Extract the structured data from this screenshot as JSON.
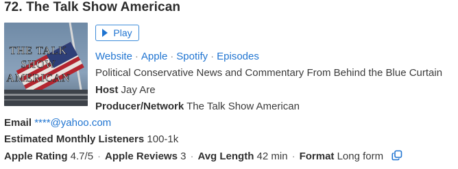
{
  "header": {
    "title": "72. The Talk Show American"
  },
  "cover": {
    "text_line1": "THE TALK",
    "text_line2": "SHOW",
    "text_line3": "AMERICAN"
  },
  "play_button": {
    "label": "Play",
    "icon": "play-icon"
  },
  "links": {
    "website": "Website",
    "apple": "Apple",
    "spotify": "Spotify",
    "episodes": "Episodes",
    "separator": "·"
  },
  "description": "Political Conservative News and Commentary From Behind the Blue Curtain",
  "host": {
    "label": "Host",
    "value": "Jay Are"
  },
  "producer": {
    "label": "Producer/Network",
    "value": "The Talk Show American"
  },
  "email": {
    "label": "Email",
    "value": "****@yahoo.com"
  },
  "listeners": {
    "label": "Estimated Monthly Listeners",
    "value": "100-1k"
  },
  "stats": {
    "rating_label": "Apple Rating",
    "rating_value": "4.7/5",
    "reviews_label": "Apple Reviews",
    "reviews_value": "3",
    "avg_length_label": "Avg Length",
    "avg_length_value": "42 min",
    "format_label": "Format",
    "format_value": "Long form",
    "separator": "·",
    "copy_icon": "copy-icon"
  },
  "colors": {
    "link": "#1f74d1",
    "text": "#3a3a3a"
  }
}
